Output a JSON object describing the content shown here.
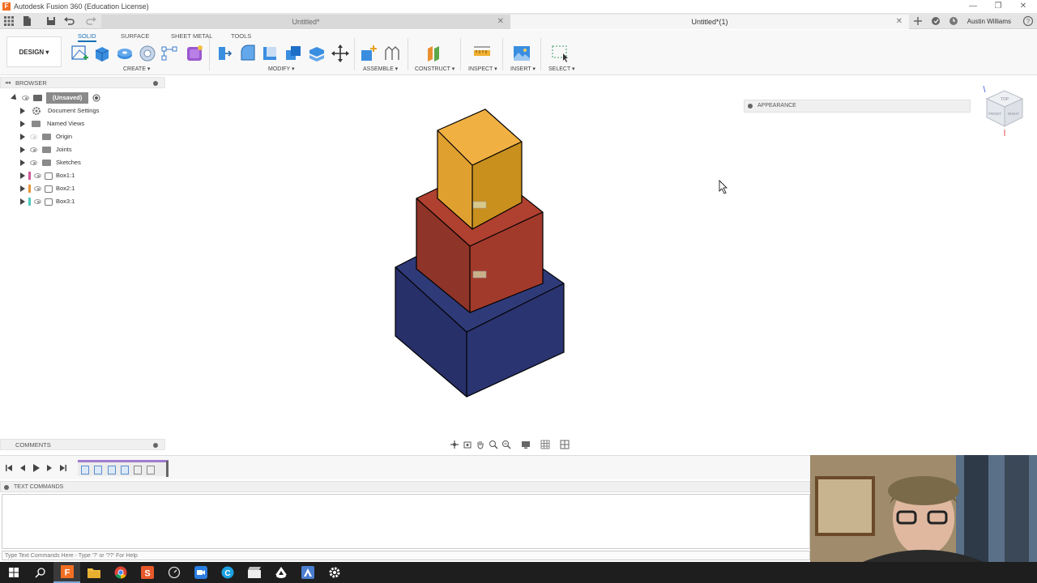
{
  "window": {
    "title": "Autodesk Fusion 360 (Education License)",
    "app_icon_letter": "F",
    "controls": [
      "—",
      "❐",
      "✕"
    ]
  },
  "tabs": {
    "inactive_label": "Untitled*",
    "active_label": "Untitled*(1)",
    "close_glyph": "✕",
    "user_name": "Austin Williams"
  },
  "toolbar": {
    "workspace_button": "DESIGN ▾",
    "workspace_tabs": [
      "SOLID",
      "SURFACE",
      "SHEET METAL",
      "TOOLS"
    ],
    "active_tab": "SOLID",
    "groups": [
      "CREATE ▾",
      "MODIFY ▾",
      "ASSEMBLE ▾",
      "CONSTRUCT ▾",
      "INSPECT ▾",
      "INSERT ▾",
      "SELECT ▾"
    ]
  },
  "browser": {
    "header": "BROWSER",
    "root_label": "(Unsaved)",
    "items": [
      {
        "label": "Document Settings",
        "icon": "gear-icon"
      },
      {
        "label": "Named Views",
        "icon": "folder-icon"
      },
      {
        "label": "Origin",
        "icon": "folder-icon"
      },
      {
        "label": "Joints",
        "icon": "folder-icon"
      },
      {
        "label": "Sketches",
        "icon": "folder-icon"
      },
      {
        "label": "Box1:1",
        "icon": "body-icon",
        "color": "#d05a9a"
      },
      {
        "label": "Box2:1",
        "icon": "body-icon",
        "color": "#e8963a"
      },
      {
        "label": "Box3:1",
        "icon": "body-icon",
        "color": "#4ecbc0"
      }
    ]
  },
  "viewport": {
    "appearance_panel": "APPEARANCE",
    "viewcube_labels": [
      "TOP",
      "FRONT",
      "RIGHT"
    ],
    "boxes": [
      {
        "name": "blue-box",
        "top": "#2f3a78",
        "left": "#28306a",
        "right": "#2a3470"
      },
      {
        "name": "red-box",
        "top": "#b04030",
        "left": "#8e3428",
        "right": "#a23a2c"
      },
      {
        "name": "yellow-box",
        "top": "#f0b042",
        "left": "#e0a030",
        "right": "#c9901e"
      }
    ]
  },
  "comments": {
    "header": "COMMENTS"
  },
  "timeline": {
    "feature_count": 6
  },
  "text_commands": {
    "header": "TEXT COMMANDS",
    "input_placeholder": "Type Text Commands Here - Type '?' or '??' For Help"
  }
}
